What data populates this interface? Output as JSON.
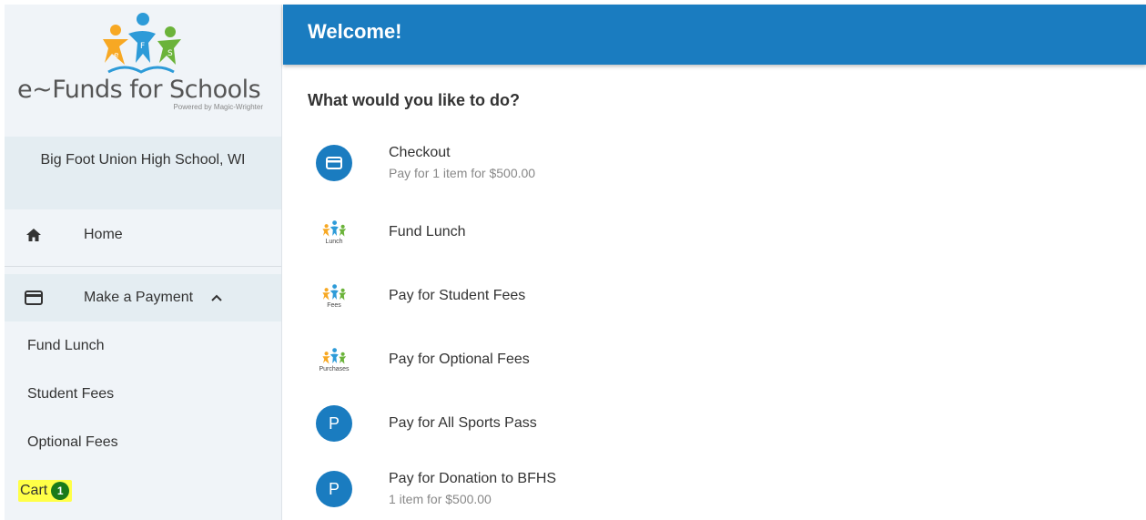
{
  "brand": {
    "name": "e~Funds for Schools",
    "powered_by": "Powered by Magic-Wrighter",
    "logo_letters": [
      "e",
      "F",
      "S"
    ]
  },
  "sidebar": {
    "school": "Big Foot Union High School, WI",
    "home_label": "Home",
    "payment_label": "Make a Payment",
    "payment_expanded": true,
    "sub_items": [
      {
        "label": "Fund Lunch"
      },
      {
        "label": "Student Fees"
      },
      {
        "label": "Optional Fees"
      }
    ],
    "cart_label": "Cart",
    "cart_count": "1"
  },
  "header": {
    "title": "Welcome!"
  },
  "main": {
    "prompt": "What would you like to do?",
    "actions": [
      {
        "icon": "card-icon",
        "title": "Checkout",
        "subtitle": "Pay for 1 item for $500.00"
      },
      {
        "icon": "efs-logo-icon",
        "caption": "Lunch",
        "title": "Fund Lunch",
        "subtitle": ""
      },
      {
        "icon": "efs-logo-icon",
        "caption": "Fees",
        "title": "Pay for Student Fees",
        "subtitle": ""
      },
      {
        "icon": "efs-logo-icon",
        "caption": "Purchases",
        "title": "Pay for Optional Fees",
        "subtitle": ""
      },
      {
        "icon": "p-circle-icon",
        "letter": "P",
        "title": "Pay for All Sports Pass",
        "subtitle": ""
      },
      {
        "icon": "p-circle-icon",
        "letter": "P",
        "title": "Pay for Donation to BFHS",
        "subtitle": "1 item for $500.00"
      }
    ]
  },
  "colors": {
    "primary": "#1a7cc0",
    "sidebar_bg": "#f0f4f8",
    "highlight": "#ffff47",
    "badge": "#1a7a1a",
    "logo_orange": "#f7a823",
    "logo_blue": "#2d9bd8",
    "logo_green": "#6bb33a"
  }
}
